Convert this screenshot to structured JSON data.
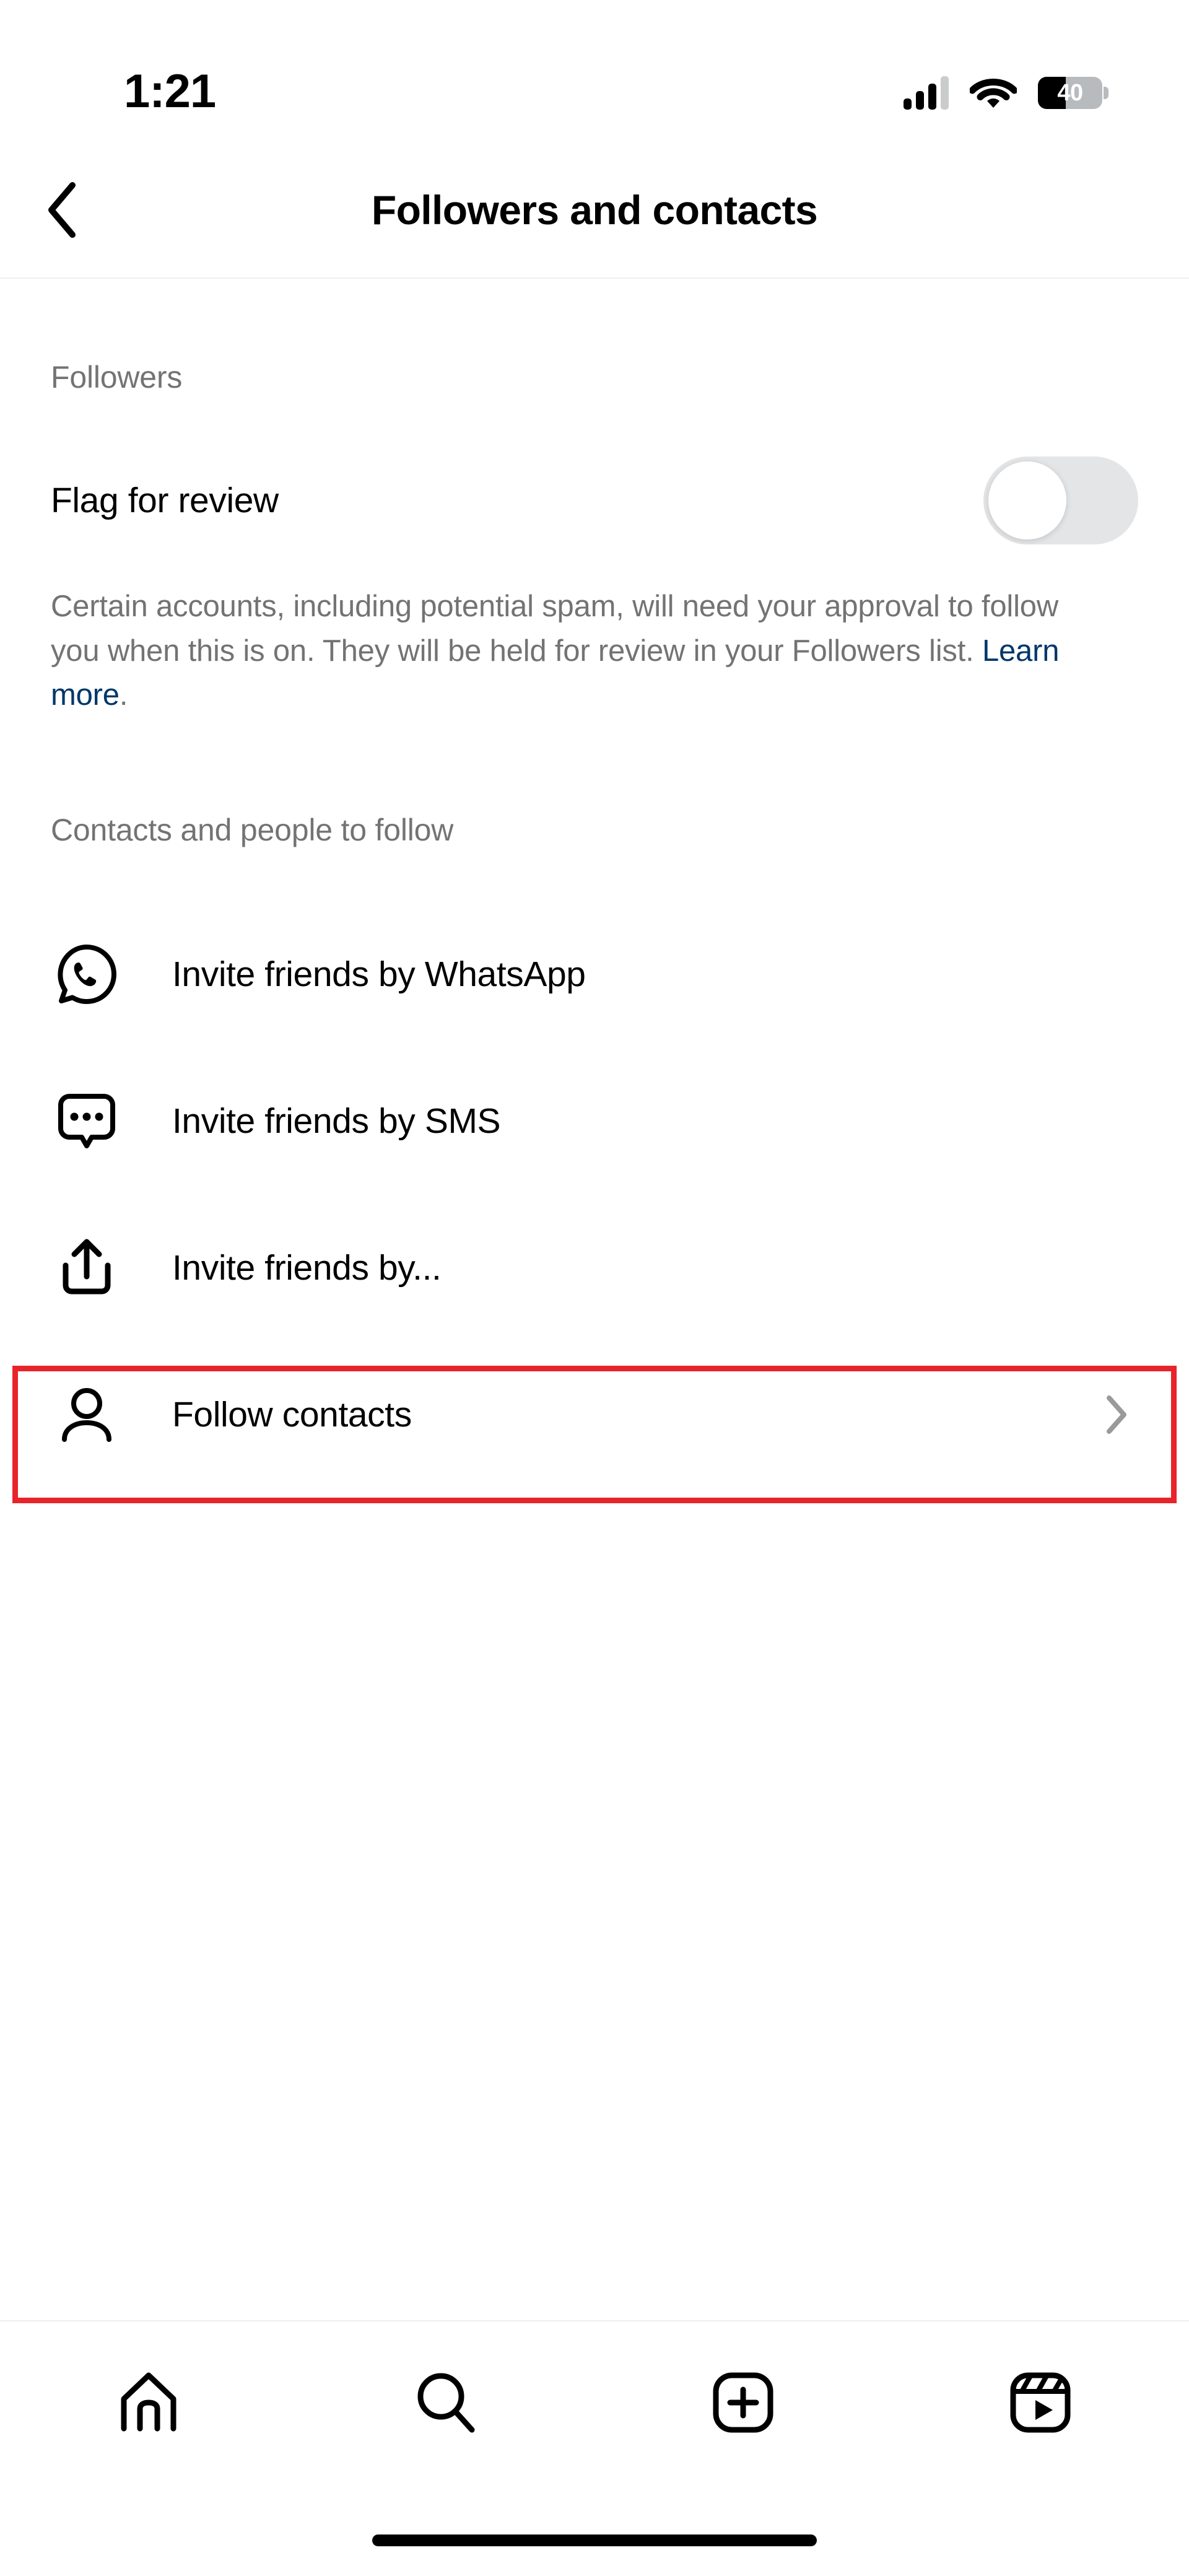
{
  "status_bar": {
    "time": "1:21",
    "cellular_icon": "cellular-signal-icon",
    "cellular_bars_filled": 3,
    "cellular_bars_total": 4,
    "wifi_icon": "wifi-icon",
    "battery_icon": "battery-icon",
    "battery_level": "40",
    "battery_percent": 40
  },
  "header": {
    "back_icon": "chevron-left-icon",
    "title": "Followers and contacts"
  },
  "followers_section": {
    "label": "Followers",
    "toggle_row": {
      "label": "Flag for review",
      "toggle_state": "off"
    },
    "description": {
      "text": "Certain accounts, including potential spam, will need your approval to follow you when this is on. They will be held for review in your Followers list. ",
      "link_text": "Learn more",
      "trailing": "."
    }
  },
  "contacts_section": {
    "label": "Contacts and people to follow",
    "items": [
      {
        "label": "Invite friends by WhatsApp",
        "icon": "whatsapp-icon",
        "has_chevron": false,
        "highlighted": false
      },
      {
        "label": "Invite friends by SMS",
        "icon": "sms-bubble-icon",
        "has_chevron": false,
        "highlighted": false
      },
      {
        "label": "Invite friends by...",
        "icon": "share-icon",
        "has_chevron": false,
        "highlighted": false
      },
      {
        "label": "Follow contacts",
        "icon": "person-icon",
        "has_chevron": true,
        "highlighted": true,
        "chevron_icon": "chevron-right-icon"
      }
    ]
  },
  "tab_bar": {
    "items": [
      {
        "name": "home",
        "icon": "home-icon"
      },
      {
        "name": "search",
        "icon": "search-icon"
      },
      {
        "name": "create",
        "icon": "plus-square-icon"
      },
      {
        "name": "reels",
        "icon": "reels-icon"
      }
    ]
  },
  "colors": {
    "accent_link": "#00376B",
    "highlight_red": "#E8232A",
    "secondary_text": "#737373",
    "toggle_track_off": "#E3E5E7",
    "divider": "#EFEFEF"
  }
}
